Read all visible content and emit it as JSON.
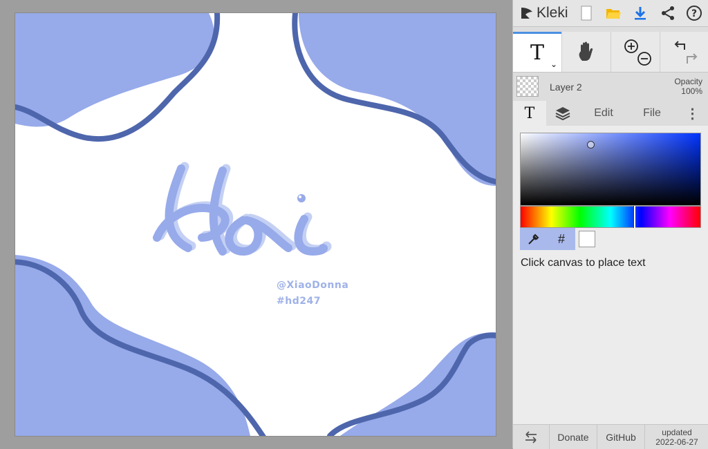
{
  "app": {
    "name": "Kleki"
  },
  "topbar": {
    "icons": [
      "kleki-logo-icon",
      "new-file-icon",
      "open-folder-icon",
      "download-icon",
      "share-icon",
      "help-icon"
    ],
    "accent": "#1a73e8"
  },
  "tools": {
    "text_tool": "T",
    "icons": [
      "text-tool-icon",
      "hand-icon",
      "zoom-in-icon",
      "zoom-out-icon",
      "undo-icon",
      "redo-icon"
    ]
  },
  "layer": {
    "name": "Layer 2",
    "opacity_label": "Opacity",
    "opacity_value": "100%"
  },
  "tabs": [
    {
      "label": "T",
      "icon": "text-icon"
    },
    {
      "label": "",
      "icon": "layers-icon"
    },
    {
      "label": "Edit"
    },
    {
      "label": "File"
    },
    {
      "label": "⋮",
      "icon": "more-icon"
    }
  ],
  "color_panel": {
    "hex_button": "#",
    "current_color": "#ffffff",
    "hint": "Click canvas to place text"
  },
  "canvas": {
    "text_handle": "@XiaoDonna",
    "text_tag": "#hd247",
    "colors": {
      "fill": "#97aaea",
      "stroke": "#4e66ac",
      "lettering": "#9fb1e8"
    }
  },
  "footer": {
    "donate": "Donate",
    "github": "GitHub",
    "updated_label": "updated",
    "updated_date": "2022-06-27"
  }
}
